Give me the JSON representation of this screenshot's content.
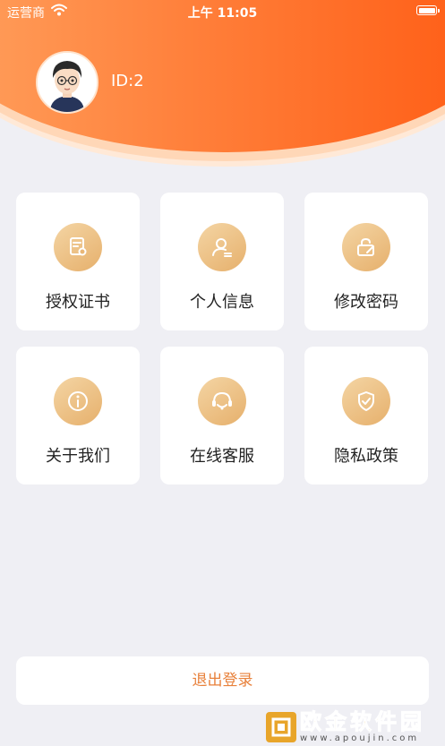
{
  "status_bar": {
    "carrier": "运营商",
    "time": "上午 11:05"
  },
  "profile": {
    "id_label": "ID:2"
  },
  "menu": [
    {
      "label": "授权证书",
      "icon": "certificate-icon"
    },
    {
      "label": "个人信息",
      "icon": "user-profile-icon"
    },
    {
      "label": "修改密码",
      "icon": "lock-edit-icon"
    },
    {
      "label": "关于我们",
      "icon": "info-icon"
    },
    {
      "label": "在线客服",
      "icon": "headset-icon"
    },
    {
      "label": "隐私政策",
      "icon": "shield-check-icon"
    }
  ],
  "logout_label": "退出登录",
  "watermark": {
    "name": "欧金软件园",
    "url": "www.apoujin.com"
  },
  "colors": {
    "header_orange": "#ff6d24",
    "icon_gold": "#e6b06c",
    "logout_text": "#e8813b",
    "background": "#efeff4"
  }
}
